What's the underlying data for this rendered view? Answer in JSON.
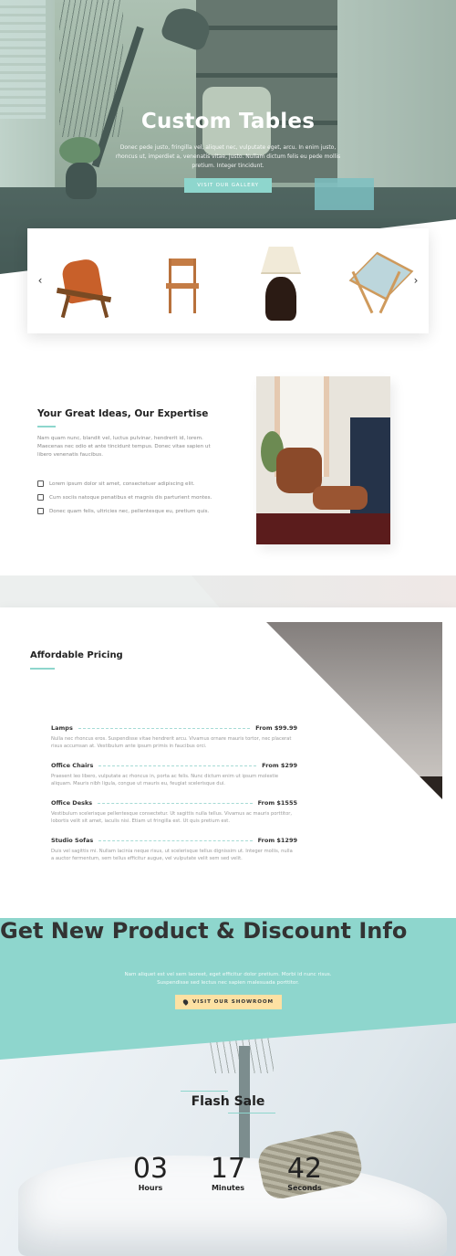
{
  "hero": {
    "title": "Custom Tables",
    "subtitle": "Donec pede justo, fringilla vel, aliquet nec, vulputate eget, arcu. In enim justo, rhoncus ut, imperdiet a, venenatis vitae, justo. Nullam dictum felis eu pede mollis pretium. Integer tincidunt.",
    "button_label": "VISIT OUR GALLERY"
  },
  "carousel": {
    "prev_icon": "‹",
    "next_icon": "›",
    "items": [
      "lounge-chair",
      "wooden-chair",
      "table-lamp",
      "beach-chair"
    ]
  },
  "feature": {
    "title": "Your Great Ideas, Our Expertise",
    "description": "Nam quam nunc, blandit vel, luctus pulvinar, hendrerit id, lorem. Maecenas nec odio et ante tincidunt tempus. Donec vitae sapien ut libero venenatis faucibus.",
    "list": [
      "Lorem ipsum dolor sit amet, consectetuer adipiscing elit.",
      "Cum sociis natoque penatibus et magnis dis parturient montes.",
      "Donec quam felis, ultricies nec, pellentesque eu, pretium quis."
    ]
  },
  "pricing": {
    "title": "Affordable Pricing",
    "items": [
      {
        "name": "Lamps",
        "price": "From $99.99",
        "desc": "Nulla nec rhoncus eros. Suspendisse vitae hendrerit arcu. Vivamus ornare mauris tortor, nec placerat risus accumsan at. Vestibulum ante ipsum primis in faucibus orci."
      },
      {
        "name": "Office Chairs",
        "price": "From $299",
        "desc": "Praesent leo libero, vulputate ac rhoncus in, porta ac felis. Nunc dictum enim ut ipsum molestie aliquam. Mauris nibh ligula, congue ut mauris eu, feugiat scelerisque dui."
      },
      {
        "name": "Office Desks",
        "price": "From $1555",
        "desc": "Vestibulum scelerisque pellentesque consectetur. Ut sagittis nulla tellus. Vivamus ac mauris porttitor, lobortis velit sit amet, iaculis nisi. Etiam ut fringilla est. Ut quis pretium est."
      },
      {
        "name": "Studio Sofas",
        "price": "From $1299",
        "desc": "Duis vel sagittis mi. Nullam lacinia neque risus, ut scelerisque tellus dignissim ut. Integer mollis, nulla a auctor fermentum, sem tellus efficitur augue, vel vulputate velit sem sed velit."
      }
    ]
  },
  "newsletter": {
    "title": "Get New Product & Discount Info",
    "subtitle": "Nam aliquet est vel sem laoreet, eget efficitur dolor pretium. Morbi id nunc risus. Suspendisse sed lectus nec sapien malesuada porttitor.",
    "button_label": "VISIT OUR SHOWROOM"
  },
  "flash_sale": {
    "title": "Flash Sale",
    "hours": "03",
    "hours_label": "Hours",
    "minutes": "17",
    "minutes_label": "Minutes",
    "seconds": "42",
    "seconds_label": "Seconds"
  },
  "colors": {
    "accent": "#8ed6cd",
    "button_yellow": "#fde1a3"
  }
}
